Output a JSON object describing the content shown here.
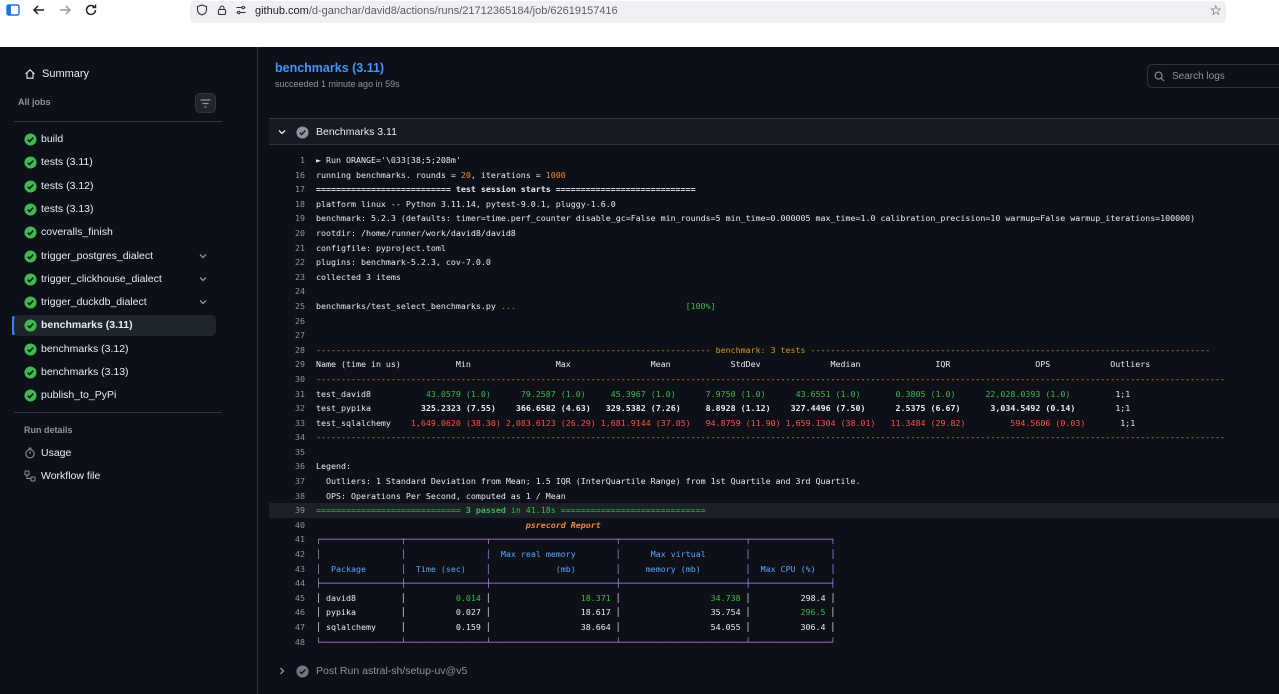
{
  "browser": {
    "url_host": "github.com",
    "url_path": "/d-ganchar/david8/actions/runs/21712365184/job/62619157416"
  },
  "sidebar": {
    "summary": "Summary",
    "all_jobs": "All jobs",
    "jobs": [
      {
        "label": "build",
        "expandable": false
      },
      {
        "label": "tests (3.11)",
        "expandable": false
      },
      {
        "label": "tests (3.12)",
        "expandable": false
      },
      {
        "label": "tests (3.13)",
        "expandable": false
      },
      {
        "label": "coveralls_finish",
        "expandable": false
      },
      {
        "label": "trigger_postgres_dialect",
        "expandable": true
      },
      {
        "label": "trigger_clickhouse_dialect",
        "expandable": true
      },
      {
        "label": "trigger_duckdb_dialect",
        "expandable": true
      },
      {
        "label": "benchmarks (3.11)",
        "expandable": false,
        "active": true
      },
      {
        "label": "benchmarks (3.12)",
        "expandable": false
      },
      {
        "label": "benchmarks (3.13)",
        "expandable": false
      },
      {
        "label": "publish_to_PyPi",
        "expandable": false
      }
    ],
    "run_details": "Run details",
    "details": [
      {
        "label": "Usage",
        "icon": "stopwatch-icon"
      },
      {
        "label": "Workflow file",
        "icon": "workflow-icon"
      }
    ]
  },
  "main": {
    "title": "benchmarks (3.11)",
    "subtitle": "succeeded 1 minute ago in 59s",
    "search_placeholder": "Search logs",
    "step_label": "Benchmarks 3.11",
    "post_step_label": "Post Run astral-sh/setup-uv@v5"
  },
  "log_lines": [
    {
      "n": "1",
      "parts": [
        [
          "► Run ORANGE='\\033[38;5;208m'",
          ""
        ]
      ]
    },
    {
      "n": "16",
      "parts": [
        [
          "running benchmarks. rounds = ",
          ""
        ],
        [
          "20",
          "c-orange"
        ],
        [
          ", iterations = ",
          ""
        ],
        [
          "1000",
          "c-orange"
        ]
      ]
    },
    {
      "n": "17",
      "parts": [
        [
          "=========================== ",
          "c-bold"
        ],
        [
          "test session starts",
          "c-bold"
        ],
        [
          " ============================",
          "c-bold"
        ]
      ]
    },
    {
      "n": "18",
      "parts": [
        [
          "platform linux -- Python 3.11.14, pytest-9.0.1, pluggy-1.6.0",
          ""
        ]
      ]
    },
    {
      "n": "19",
      "parts": [
        [
          "benchmark: 5.2.3 (defaults: timer=time.perf_counter disable_gc=False min_rounds=5 min_time=0.000005 max_time=1.0 calibration_precision=10 warmup=False warmup_iterations=100000)",
          ""
        ]
      ]
    },
    {
      "n": "20",
      "parts": [
        [
          "rootdir: /home/runner/work/david8/david8",
          ""
        ]
      ]
    },
    {
      "n": "21",
      "parts": [
        [
          "configfile: pyproject.toml",
          ""
        ]
      ]
    },
    {
      "n": "22",
      "parts": [
        [
          "plugins: benchmark-5.2.3, cov-7.0.0",
          ""
        ]
      ]
    },
    {
      "n": "23",
      "parts": [
        [
          "collected 3 items",
          ""
        ]
      ]
    },
    {
      "n": "24",
      "parts": []
    },
    {
      "n": "25",
      "parts": [
        [
          "benchmarks/test_select_benchmarks.py ",
          ""
        ],
        [
          "...",
          "c-green"
        ],
        [
          "                                  ",
          ""
        ],
        [
          "[100%]",
          "c-green"
        ]
      ]
    },
    {
      "n": "26",
      "parts": []
    },
    {
      "n": "27",
      "parts": []
    },
    {
      "n": "28",
      "parts": [
        [
          "------------------------------------------------------------------------------- ",
          "c-yel"
        ],
        [
          "benchmark: 3 tests",
          "c-yel"
        ],
        [
          " --------------------------------------------------------------------------------",
          "c-yel"
        ]
      ]
    },
    {
      "n": "29",
      "parts": [
        [
          "Name (time in us)           Min                 Max                Mean            StdDev              Median               IQR                 OPS            Outliers",
          ""
        ]
      ]
    },
    {
      "n": "30",
      "parts": [
        [
          "--------------------------------------------------------------------------------------------------------------------------------------------------------------------------------------",
          "c-yel"
        ]
      ]
    },
    {
      "n": "31",
      "parts": [
        [
          "test_david8        ",
          ""
        ],
        [
          "   43.0579 (1.0)   ",
          "c-green"
        ],
        [
          "   79.2587 (1.0)   ",
          "c-green"
        ],
        [
          "  45.3967 (1.0)   ",
          "c-green"
        ],
        [
          "   7.9750 (1.0)   ",
          "c-green"
        ],
        [
          "   43.6551 (1.0)   ",
          "c-green"
        ],
        [
          "    0.3805 (1.0)   ",
          "c-green"
        ],
        [
          "   22,028.0393 (1.0)   ",
          "c-green"
        ],
        [
          "      1;1",
          ""
        ]
      ]
    },
    {
      "n": "32",
      "parts": [
        [
          "test_pypika        ",
          ""
        ],
        [
          "  325.2323 (7.55)  ",
          "c-bold"
        ],
        [
          "  366.6582 (4.63)  ",
          "c-bold"
        ],
        [
          " 329.5382 (7.26)  ",
          "c-bold"
        ],
        [
          "   8.8928 (1.12)  ",
          "c-bold"
        ],
        [
          "  327.4496 (7.50)  ",
          "c-bold"
        ],
        [
          "    2.5375 (6.67)  ",
          "c-bold"
        ],
        [
          "    3,034.5492 (0.14)  ",
          "c-bold"
        ],
        [
          "      1;1",
          ""
        ]
      ]
    },
    {
      "n": "33",
      "parts": [
        [
          "test_sqlalchemy    ",
          ""
        ],
        [
          "1,649.0620 (38.30) ",
          "c-red"
        ],
        [
          "2,083.6123 (26.29) ",
          "c-red"
        ],
        [
          "1,681.9144 (37.05) ",
          "c-red"
        ],
        [
          "  94.8759 (11.90) ",
          "c-red"
        ],
        [
          "1,659.1304 (38.01) ",
          "c-red"
        ],
        [
          "  11.3484 (29.82) ",
          "c-red"
        ],
        [
          "        594.5606 (0.03)   ",
          "c-red"
        ],
        [
          "    1;1",
          ""
        ]
      ]
    },
    {
      "n": "34",
      "parts": [
        [
          "--------------------------------------------------------------------------------------------------------------------------------------------------------------------------------------",
          "c-yel"
        ]
      ]
    },
    {
      "n": "35",
      "parts": []
    },
    {
      "n": "36",
      "parts": [
        [
          "Legend:",
          ""
        ]
      ]
    },
    {
      "n": "37",
      "parts": [
        [
          "  Outliers: 1 Standard Deviation from Mean; 1.5 IQR (InterQuartile Range) from 1st Quartile and 3rd Quartile.",
          ""
        ]
      ]
    },
    {
      "n": "38",
      "parts": [
        [
          "  OPS: Operations Per Second, computed as 1 / Mean",
          ""
        ]
      ]
    },
    {
      "n": "39",
      "parts": [
        [
          "============================= ",
          "c-green"
        ],
        [
          "3 passed",
          "c-green c-bold"
        ],
        [
          " in 41.18s",
          "c-green"
        ],
        [
          " =============================",
          "c-green"
        ]
      ],
      "hl": true
    },
    {
      "n": "40",
      "parts": [
        [
          "                                          ",
          ""
        ],
        [
          "psrecord Report",
          "c-orange c-italic c-bold"
        ]
      ]
    },
    {
      "n": "41",
      "parts": [
        [
          "┌────────────────┬────────────────┬─────────────────────────┬─────────────────────────┬────────────────┐",
          "c-purple"
        ]
      ]
    },
    {
      "n": "42",
      "parts": [
        [
          "│",
          "c-purple"
        ],
        [
          "                ",
          ""
        ],
        [
          "│",
          "c-purple"
        ],
        [
          "                ",
          ""
        ],
        [
          "│",
          "c-purple"
        ],
        [
          "  Max real memory        ",
          "c-blue"
        ],
        [
          "│",
          "c-purple"
        ],
        [
          "      Max virtual        ",
          "c-blue"
        ],
        [
          "│",
          "c-purple"
        ],
        [
          "                ",
          ""
        ],
        [
          "│",
          "c-purple"
        ]
      ]
    },
    {
      "n": "43",
      "parts": [
        [
          "│",
          "c-purple"
        ],
        [
          "  Package       ",
          "c-blue"
        ],
        [
          "│",
          "c-purple"
        ],
        [
          "  Time (sec)    ",
          "c-blue"
        ],
        [
          "│",
          "c-purple"
        ],
        [
          "             (mb)        ",
          "c-blue"
        ],
        [
          "│",
          "c-purple"
        ],
        [
          "     memory (mb)         ",
          "c-blue"
        ],
        [
          "│",
          "c-purple"
        ],
        [
          "  Max CPU (%)   ",
          "c-blue"
        ],
        [
          "│",
          "c-purple"
        ]
      ]
    },
    {
      "n": "44",
      "parts": [
        [
          "├────────────────┼────────────────┼─────────────────────────┼─────────────────────────┼────────────────┤",
          "c-purple"
        ]
      ]
    },
    {
      "n": "45",
      "parts": [
        [
          "│ david8         │",
          "c-white"
        ],
        [
          "          0.014 ",
          "c-green"
        ],
        [
          "│",
          "c-white"
        ],
        [
          "                  18.371 ",
          "c-green"
        ],
        [
          "│",
          "c-white"
        ],
        [
          "                  34.738 ",
          "c-green"
        ],
        [
          "│",
          "c-white"
        ],
        [
          "          298.4 │",
          "c-white"
        ]
      ]
    },
    {
      "n": "46",
      "parts": [
        [
          "│ pypika         │          0.027 │                  18.617 │                  35.754 │",
          "c-white"
        ],
        [
          "          296.5 ",
          "c-green"
        ],
        [
          "│",
          "c-white"
        ]
      ]
    },
    {
      "n": "47",
      "parts": [
        [
          "│ sqlalchemy     │          0.159 │                  38.664 │                  54.055 │          306.4 │",
          "c-white"
        ]
      ]
    },
    {
      "n": "48",
      "parts": [
        [
          "└────────────────┴────────────────┴─────────────────────────┴─────────────────────────┴────────────────┘",
          "c-purple"
        ]
      ]
    }
  ],
  "colors": {
    "bg": "#0d1117",
    "accent": "#4493f8",
    "success": "#3fb950"
  }
}
